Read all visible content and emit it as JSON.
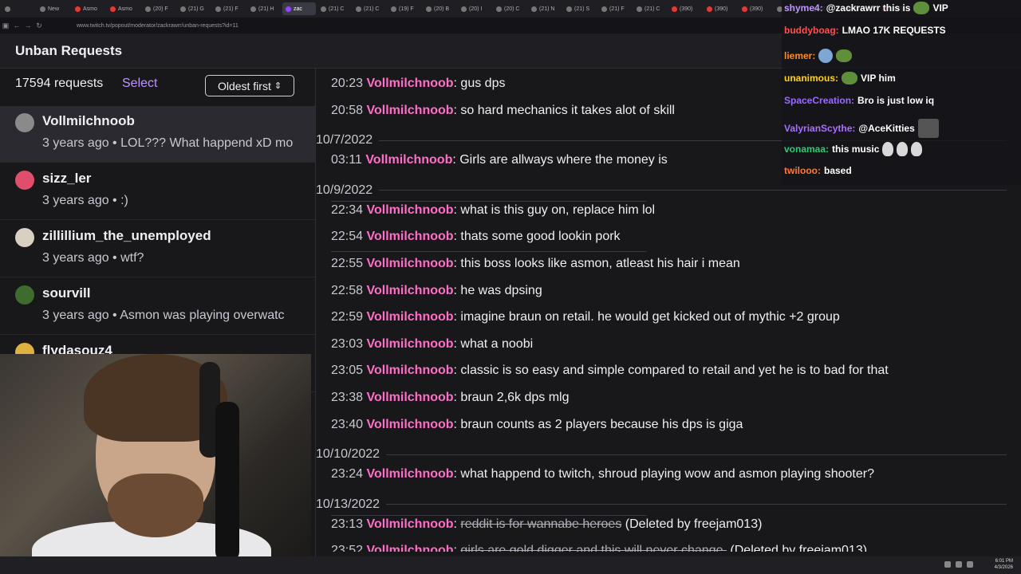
{
  "browser": {
    "tabs": [
      {
        "label": "",
        "icon": "page-icon"
      },
      {
        "label": "New",
        "icon": "new-tab-icon"
      },
      {
        "label": "Asmo",
        "icon": "youtube-icon"
      },
      {
        "label": "Asmo",
        "icon": "youtube-icon"
      },
      {
        "label": "(20) F",
        "icon": "x-icon"
      },
      {
        "label": "(21) G",
        "icon": "x-icon"
      },
      {
        "label": "(21) F",
        "icon": "x-icon"
      },
      {
        "label": "(21) H",
        "icon": "x-icon"
      },
      {
        "label": "zac",
        "icon": "twitch-icon",
        "active": true
      },
      {
        "label": "(21) C",
        "icon": "x-icon"
      },
      {
        "label": "(21) C",
        "icon": "x-icon"
      },
      {
        "label": "(19) F",
        "icon": "x-icon"
      },
      {
        "label": "(20) B",
        "icon": "x-icon"
      },
      {
        "label": "(20) I",
        "icon": "x-icon"
      },
      {
        "label": "(20) C",
        "icon": "x-icon"
      },
      {
        "label": "(21) N",
        "icon": "x-icon"
      },
      {
        "label": "(21) S",
        "icon": "x-icon"
      },
      {
        "label": "(21) F",
        "icon": "x-icon"
      },
      {
        "label": "(21) C",
        "icon": "x-icon"
      },
      {
        "label": "(390)",
        "icon": "youtube-icon"
      },
      {
        "label": "(390)",
        "icon": "youtube-icon"
      },
      {
        "label": "(390)",
        "icon": "youtube-icon"
      },
      {
        "label": "(20)",
        "icon": "x-icon"
      },
      {
        "label": "(21) I",
        "icon": "x-icon"
      },
      {
        "label": "(21) C",
        "icon": "x-icon"
      },
      {
        "label": "(390)",
        "icon": "youtube-icon"
      }
    ],
    "url": "www.twitch.tv/popout/moderator/zackrawrr/unban-requests?id=11"
  },
  "page": {
    "title": "Unban Requests"
  },
  "requests_panel": {
    "count_label": "17594 requests",
    "select_label": "Select",
    "sort_label": "Oldest first",
    "items": [
      {
        "name": "Vollmilchnoob",
        "meta": "3 years ago • LOL??? What happend xD mo",
        "avatar_color": "#8a8a8a",
        "selected": true
      },
      {
        "name": "sizz_ler",
        "meta": "3 years ago • :)",
        "avatar_color": "#e04e6b"
      },
      {
        "name": "zillillium_the_unemployed",
        "meta": "3 years ago • wtf?",
        "avatar_color": "#d8d0c0"
      },
      {
        "name": "sourvill",
        "meta": "3 years ago • Asmon was playing overwatc",
        "avatar_color": "#3e6b2e"
      },
      {
        "name": "flydasouz4",
        "meta": "",
        "avatar_color": "#e0b040"
      }
    ]
  },
  "chat_log": {
    "entries": [
      {
        "kind": "msg",
        "time": "20:23",
        "user": "Vollmilchnoob",
        "text": "gus dps"
      },
      {
        "kind": "msg",
        "time": "20:58",
        "user": "Vollmilchnoob",
        "text": "so hard mechanics it takes alot of skill"
      },
      {
        "kind": "date",
        "text": "10/7/2022"
      },
      {
        "kind": "msg",
        "time": "03:11",
        "user": "Vollmilchnoob",
        "text": "Girls are allways where the money is"
      },
      {
        "kind": "date",
        "text": "10/9/2022"
      },
      {
        "kind": "msg",
        "time": "22:34",
        "user": "Vollmilchnoob",
        "text": "what is this guy on, replace him lol"
      },
      {
        "kind": "msg",
        "time": "22:54",
        "user": "Vollmilchnoob",
        "text": "thats some good lookin pork"
      },
      {
        "kind": "msg",
        "time": "22:55",
        "user": "Vollmilchnoob",
        "text": "this boss looks like asmon, atleast his hair i mean"
      },
      {
        "kind": "msg",
        "time": "22:58",
        "user": "Vollmilchnoob",
        "text": "he was dpsing"
      },
      {
        "kind": "msg",
        "time": "22:59",
        "user": "Vollmilchnoob",
        "text": "imagine braun on retail. he would get kicked out of mythic +2 group"
      },
      {
        "kind": "msg",
        "time": "23:03",
        "user": "Vollmilchnoob",
        "text": "what a noobi"
      },
      {
        "kind": "msg",
        "time": "23:05",
        "user": "Vollmilchnoob",
        "text": "classic is so easy and simple compared to retail and yet he is to bad for that"
      },
      {
        "kind": "msg",
        "time": "23:38",
        "user": "Vollmilchnoob",
        "text": "braun 2,6k dps mlg"
      },
      {
        "kind": "msg",
        "time": "23:40",
        "user": "Vollmilchnoob",
        "text": "braun counts as 2 players because his dps is giga"
      },
      {
        "kind": "date",
        "text": "10/10/2022"
      },
      {
        "kind": "msg",
        "time": "23:24",
        "user": "Vollmilchnoob",
        "text": "what happend to twitch, shroud playing wow and asmon playing shooter?"
      },
      {
        "kind": "date",
        "text": "10/13/2022"
      },
      {
        "kind": "deleted",
        "time": "23:13",
        "user": "Vollmilchnoob",
        "text": "reddit is for wannabe heroes",
        "note": "(Deleted by freejam013)"
      },
      {
        "kind": "deleted",
        "time": "23:52",
        "user": "Vollmilchnoob",
        "text": "girls are gold digger and this will never change.",
        "note": "(Deleted by freejam013)"
      }
    ]
  },
  "stream_chat": {
    "lines": [
      {
        "user": "shyme4:",
        "color": "#bf94ff",
        "text": "@zackrawrr this is",
        "emotes": [
          "frog"
        ],
        "tail": "VIP"
      },
      {
        "user": "buddyboag:",
        "color": "#ff4f4f",
        "text": "LMAO 17K REQUESTS",
        "emotes": [],
        "tail": ""
      },
      {
        "user": "liemer:",
        "color": "#ff8c1a",
        "text": "",
        "emotes": [
          "blue",
          "frog"
        ],
        "tail": ""
      },
      {
        "user": "unanimous:",
        "color": "#ffd11a",
        "text": "",
        "emotes": [
          "frog"
        ],
        "tail": "VIP him"
      },
      {
        "user": "SpaceCreation:",
        "color": "#9a6bff",
        "text": "Bro is just low iq",
        "emotes": [],
        "tail": ""
      },
      {
        "user": "ValyrianScythe:",
        "color": "#a970ff",
        "text": "@AceKitties",
        "emotes": [
          "dark"
        ],
        "tail": ""
      },
      {
        "user": "vonamaa:",
        "color": "#2ecc71",
        "text": "this music",
        "emotes": [
          "skull",
          "skull",
          "skull"
        ],
        "tail": ""
      },
      {
        "user": "twilooo:",
        "color": "#ff7a3d",
        "text": "based",
        "emotes": [],
        "tail": ""
      }
    ]
  },
  "taskbar": {
    "time": "6:01 PM",
    "date": "4/3/2026"
  }
}
